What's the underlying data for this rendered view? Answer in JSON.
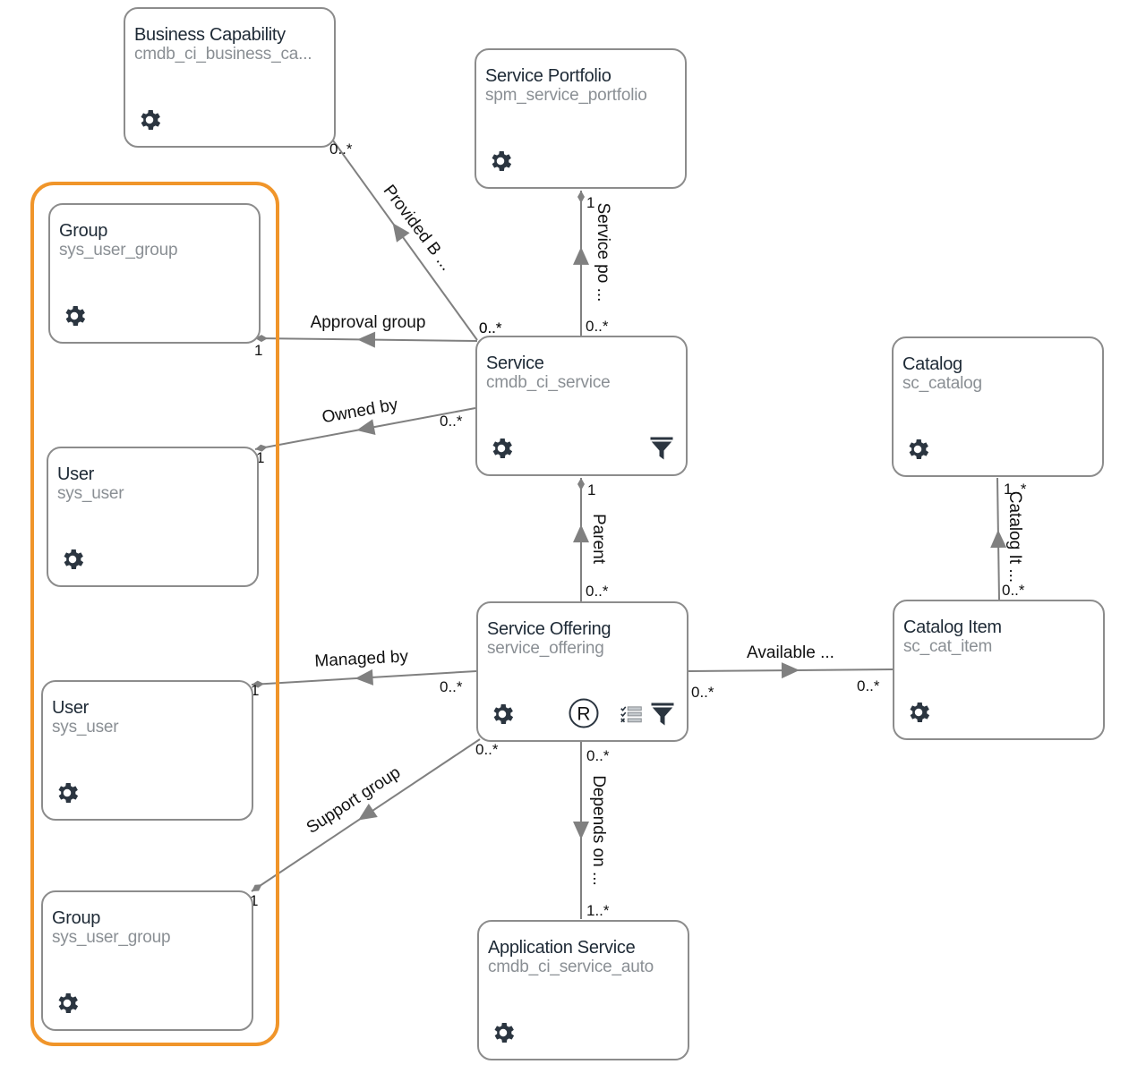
{
  "colors": {
    "highlight": "#f0952a",
    "node_border": "#8c8c8c",
    "edge": "#808080",
    "title": "#1e2a36",
    "table": "#8a8f94"
  },
  "nodes": {
    "business_capability": {
      "title": "Business Capability",
      "table": "cmdb_ci_business_ca...",
      "icons": [
        "gear-icon"
      ]
    },
    "service_portfolio": {
      "title": "Service Portfolio",
      "table": "spm_service_portfolio",
      "icons": [
        "gear-icon"
      ]
    },
    "group_1": {
      "title": "Group",
      "table": "sys_user_group",
      "icons": [
        "gear-icon"
      ]
    },
    "user_1": {
      "title": "User",
      "table": "sys_user",
      "icons": [
        "gear-icon"
      ]
    },
    "user_2": {
      "title": "User",
      "table": "sys_user",
      "icons": [
        "gear-icon"
      ]
    },
    "group_2": {
      "title": "Group",
      "table": "sys_user_group",
      "icons": [
        "gear-icon"
      ]
    },
    "service": {
      "title": "Service",
      "table": "cmdb_ci_service",
      "icons": [
        "gear-icon",
        "filter-icon"
      ]
    },
    "catalog": {
      "title": "Catalog",
      "table": "sc_catalog",
      "icons": [
        "gear-icon"
      ]
    },
    "service_offering": {
      "title": "Service Offering",
      "table": "service_offering",
      "icons": [
        "gear-icon",
        "registered-icon",
        "checklist-icon",
        "filter-icon"
      ]
    },
    "catalog_item": {
      "title": "Catalog Item",
      "table": "sc_cat_item",
      "icons": [
        "gear-icon"
      ]
    },
    "application_service": {
      "title": "Application Service",
      "table": "cmdb_ci_service_auto",
      "icons": [
        "gear-icon"
      ]
    }
  },
  "edges": {
    "provided_by": {
      "label": "Provided B ...",
      "from_mult": "0..*",
      "to_mult": "0..*"
    },
    "service_portfolio": {
      "label": "Service po ...",
      "from_mult": "0..*",
      "to_mult": "1"
    },
    "approval_group": {
      "label": "Approval group",
      "from_mult": "0..*",
      "to_mult": "1"
    },
    "owned_by": {
      "label": "Owned by",
      "from_mult": "0..*",
      "to_mult": "1"
    },
    "parent": {
      "label": "Parent",
      "from_mult": "0..*",
      "to_mult": "1"
    },
    "catalog_item": {
      "label": "Catalog It ...",
      "from_mult": "0..*",
      "to_mult": "1..*"
    },
    "managed_by": {
      "label": "Managed by",
      "from_mult": "0..*",
      "to_mult": "1"
    },
    "available": {
      "label": "Available ...",
      "from_mult": "0..*",
      "to_mult": "0..*"
    },
    "support_group": {
      "label": "Support group",
      "from_mult": "0..*",
      "to_mult": "1"
    },
    "depends_on": {
      "label": "Depends on ...",
      "from_mult": "0..*",
      "to_mult": "1..*"
    }
  }
}
